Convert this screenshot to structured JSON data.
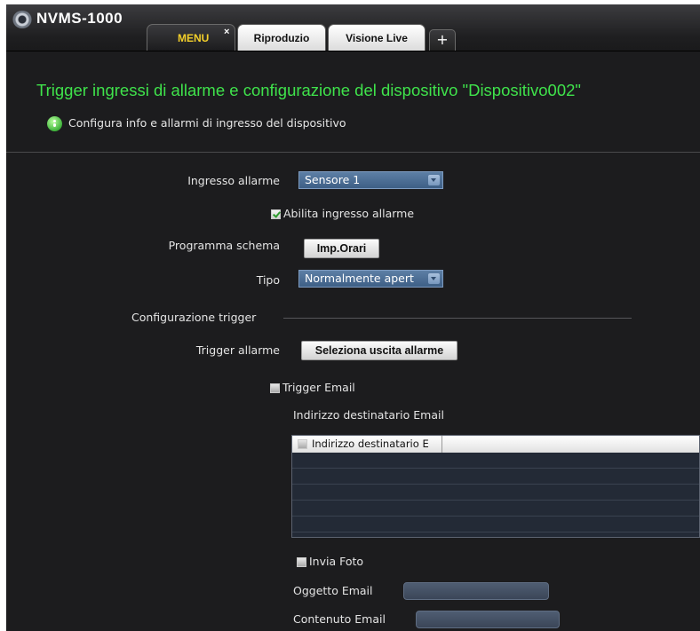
{
  "app": {
    "title": "NVMS-1000"
  },
  "tabs": [
    {
      "label": "MENU",
      "active": true,
      "closable": true,
      "close_glyph": "×"
    },
    {
      "label": "Riproduzio",
      "active": false
    },
    {
      "label": "Visione Live",
      "active": false
    }
  ],
  "add_tab_glyph": "+",
  "page": {
    "title": "Trigger ingressi di allarme e configurazione del dispositivo \"Dispositivo002\"",
    "subtitle": "Configura info e allarmi di ingresso del dispositivo"
  },
  "form": {
    "alarm_input": {
      "label": "Ingresso allarme",
      "value": "Sensore 1"
    },
    "enable_alarm_input": {
      "label": "Abilita ingresso allarme",
      "checked": true
    },
    "schedule": {
      "label": "Programma schema",
      "button": "Imp.Orari"
    },
    "type": {
      "label": "Tipo",
      "value": "Normalmente apert"
    },
    "trigger_config": {
      "label": "Configurazione trigger"
    },
    "trigger_alarm": {
      "label": "Trigger allarme",
      "button": "Seleziona uscita allarme"
    },
    "trigger_email": {
      "label": "Trigger Email",
      "checked": false
    },
    "email_recipient": {
      "label": "Indirizzo destinatario Email"
    },
    "email_list": {
      "header": "Indirizzo destinatario E",
      "rows": 5
    },
    "send_photo": {
      "label": "Invia Foto",
      "checked": false
    },
    "email_subject": {
      "label": "Oggetto Email",
      "value": ""
    },
    "email_content": {
      "label": "Contenuto Email",
      "value": ""
    }
  },
  "colors": {
    "title_green": "#3fe24b",
    "active_tab_text": "#f3cf2a",
    "select_blue": "#4a6b92",
    "background": "#1c1c1e"
  },
  "icons": {
    "logo": "camera-lens-icon",
    "info": "info-bubble-icon",
    "close": "close-icon",
    "add": "plus-icon",
    "dropdown": "chevron-down-icon"
  }
}
